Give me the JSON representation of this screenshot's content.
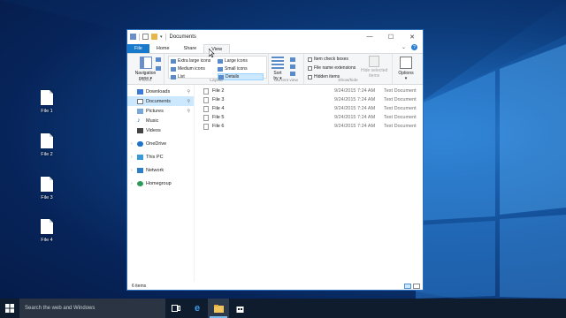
{
  "desktop": {
    "icons": [
      {
        "label": "File 1"
      },
      {
        "label": "File 2"
      },
      {
        "label": "File 3"
      },
      {
        "label": "File 4"
      }
    ]
  },
  "window": {
    "title": "Documents",
    "controls": {
      "minimize": "—",
      "maximize": "☐",
      "close": "✕"
    },
    "tabs": [
      "File",
      "Home",
      "Share",
      "View"
    ],
    "active_tab": "View"
  },
  "ribbon": {
    "panes": {
      "nav_pane": "Navigation",
      "nav_pane_2": "pane ▾",
      "group": "Panes"
    },
    "layout": {
      "items": [
        "Extra large icons",
        "Large icons",
        "Medium icons",
        "Small icons",
        "List",
        "Details"
      ],
      "selected": "Details",
      "group": "Layout"
    },
    "current_view": {
      "sort": "Sort",
      "sort_2": "by ▾",
      "group": "Current view"
    },
    "show_hide": {
      "checkboxes": [
        "Item check boxes",
        "File name extensions",
        "Hidden items"
      ],
      "hide_selected": "Hide selected",
      "hide_selected_2": "items",
      "group": "Show/hide"
    },
    "options": {
      "label": "Options",
      "arrow": "▾"
    }
  },
  "nav": {
    "quick_access": [
      "Downloads",
      "Documents",
      "Pictures",
      "Music",
      "Videos"
    ],
    "selected": "Documents",
    "onedrive": "OneDrive",
    "this_pc": "This PC",
    "network": "Network",
    "homegroup": "Homegroup"
  },
  "files": [
    {
      "name": "File 2",
      "date": "9/24/2015 7:24 AM",
      "type": "Text Document"
    },
    {
      "name": "File 3",
      "date": "9/24/2015 7:24 AM",
      "type": "Text Document"
    },
    {
      "name": "File 4",
      "date": "9/24/2015 7:24 AM",
      "type": "Text Document"
    },
    {
      "name": "File 5",
      "date": "9/24/2015 7:24 AM",
      "type": "Text Document"
    },
    {
      "name": "File 6",
      "date": "9/24/2015 7:24 AM",
      "type": "Text Document"
    }
  ],
  "status": {
    "count": "6 items"
  },
  "taskbar": {
    "search_placeholder": "Search the web and Windows"
  },
  "colors": {
    "accent": "#1979ca",
    "selection": "#cce8ff",
    "taskbar": "#0f1c2e"
  }
}
